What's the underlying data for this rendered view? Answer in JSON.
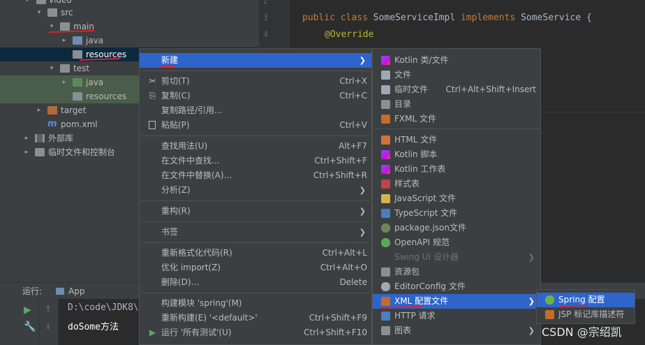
{
  "tree": {
    "items": [
      {
        "label": "video",
        "indent": 1,
        "arrow": "▸",
        "icon": "folder-grey"
      },
      {
        "label": "src",
        "indent": 1,
        "arrow": "▾",
        "icon": "folder-grey"
      },
      {
        "label": "main",
        "indent": 2,
        "arrow": "▾",
        "icon": "folder-grey"
      },
      {
        "label": "java",
        "indent": 3,
        "arrow": "▸",
        "icon": "folder-blue"
      },
      {
        "label": "resources",
        "indent": 3,
        "arrow": "",
        "icon": "folder-res"
      },
      {
        "label": "test",
        "indent": 2,
        "arrow": "▾",
        "icon": "folder-grey"
      },
      {
        "label": "java",
        "indent": 3,
        "arrow": "▸",
        "icon": "folder-blue"
      },
      {
        "label": "resources",
        "indent": 3,
        "arrow": "",
        "icon": "folder-res"
      },
      {
        "label": "target",
        "indent": 1,
        "arrow": "▸",
        "icon": "folder-brown"
      },
      {
        "label": "pom.xml",
        "indent": 1,
        "arrow": "",
        "icon": "maven"
      },
      {
        "label": "外部库",
        "indent": 0,
        "arrow": "▸",
        "icon": "lib"
      },
      {
        "label": "临时文件和控制台",
        "indent": 0,
        "arrow": "▸",
        "icon": "scratch"
      }
    ]
  },
  "editor": {
    "line_numbers": [
      "2",
      "3",
      "4"
    ],
    "code": {
      "l1_kw1": "public class ",
      "l1_name": "SomeServiceImpl ",
      "l1_kw2": "implements ",
      "l1_iface": "SomeService {",
      "l2_ann": "@Override"
    }
  },
  "run": {
    "label": "运行:",
    "tab": "App",
    "output_line1": "D:\\code\\JDK8\\",
    "output_line2": "doSome方法"
  },
  "menu1": {
    "items": [
      {
        "label": "新建",
        "shortcut": "",
        "submenu": true,
        "icon": ""
      },
      {
        "label": "剪切(T)",
        "shortcut": "Ctrl+X",
        "submenu": false,
        "icon": "✂"
      },
      {
        "label": "复制(C)",
        "shortcut": "Ctrl+C",
        "submenu": false,
        "icon": "⎘"
      },
      {
        "label": "复制路径/引用...",
        "shortcut": "",
        "submenu": false,
        "icon": ""
      },
      {
        "label": "粘贴(P)",
        "shortcut": "Ctrl+V",
        "submenu": false,
        "icon": "📋"
      },
      {
        "label": "查找用法(U)",
        "shortcut": "Alt+F7",
        "submenu": false,
        "icon": ""
      },
      {
        "label": "在文件中查找...",
        "shortcut": "Ctrl+Shift+F",
        "submenu": false,
        "icon": ""
      },
      {
        "label": "在文件中替换(A)...",
        "shortcut": "Ctrl+Shift+R",
        "submenu": false,
        "icon": ""
      },
      {
        "label": "分析(Z)",
        "shortcut": "",
        "submenu": true,
        "icon": ""
      },
      {
        "label": "重构(R)",
        "shortcut": "",
        "submenu": true,
        "icon": ""
      },
      {
        "label": "书签",
        "shortcut": "",
        "submenu": true,
        "icon": ""
      },
      {
        "label": "重新格式化代码(R)",
        "shortcut": "Ctrl+Alt+L",
        "submenu": false,
        "icon": ""
      },
      {
        "label": "优化 import(Z)",
        "shortcut": "Ctrl+Alt+O",
        "submenu": false,
        "icon": ""
      },
      {
        "label": "删除(D)...",
        "shortcut": "Delete",
        "submenu": false,
        "icon": ""
      },
      {
        "label": "构建模块 'spring'(M)",
        "shortcut": "",
        "submenu": false,
        "icon": ""
      },
      {
        "label": "重新构建(E) '<default>'",
        "shortcut": "Ctrl+Shift+F9",
        "submenu": false,
        "icon": ""
      },
      {
        "label": "运行 '所有测试'(U)",
        "shortcut": "Ctrl+Shift+F10",
        "submenu": false,
        "icon": "▶"
      }
    ]
  },
  "menu2": {
    "items": [
      {
        "label": "Kotlin 类/文件",
        "shortcut": "",
        "submenu": false,
        "icon": "kotlin"
      },
      {
        "label": "文件",
        "shortcut": "",
        "submenu": false,
        "icon": "file"
      },
      {
        "label": "临时文件",
        "shortcut": "Ctrl+Alt+Shift+Insert",
        "submenu": false,
        "icon": "file"
      },
      {
        "label": "目录",
        "shortcut": "",
        "submenu": false,
        "icon": "dir"
      },
      {
        "label": "FXML 文件",
        "shortcut": "",
        "submenu": false,
        "icon": "fxml"
      },
      {
        "label": "HTML 文件",
        "shortcut": "",
        "submenu": false,
        "icon": "html"
      },
      {
        "label": "Kotlin 脚本",
        "shortcut": "",
        "submenu": false,
        "icon": "kotlin"
      },
      {
        "label": "Kotlin 工作表",
        "shortcut": "",
        "submenu": false,
        "icon": "kotlin"
      },
      {
        "label": "样式表",
        "shortcut": "",
        "submenu": false,
        "icon": "css"
      },
      {
        "label": "JavaScript 文件",
        "shortcut": "",
        "submenu": false,
        "icon": "js"
      },
      {
        "label": "TypeScript 文件",
        "shortcut": "",
        "submenu": false,
        "icon": "ts"
      },
      {
        "label": "package.json文件",
        "shortcut": "",
        "submenu": false,
        "icon": "pkg"
      },
      {
        "label": "OpenAPI 规范",
        "shortcut": "",
        "submenu": false,
        "icon": "openapi"
      },
      {
        "label": "Swing UI 设计器",
        "shortcut": "",
        "submenu": true,
        "icon": ""
      },
      {
        "label": "资源包",
        "shortcut": "",
        "submenu": false,
        "icon": "res"
      },
      {
        "label": "EditorConfig 文件",
        "shortcut": "",
        "submenu": false,
        "icon": "gear"
      },
      {
        "label": "XML 配置文件",
        "shortcut": "",
        "submenu": true,
        "icon": "xml"
      },
      {
        "label": "HTTP 请求",
        "shortcut": "",
        "submenu": false,
        "icon": "api"
      },
      {
        "label": "图表",
        "shortcut": "",
        "submenu": true,
        "icon": "dir"
      }
    ]
  },
  "menu3": {
    "items": [
      {
        "label": "Spring 配置",
        "icon": "spring"
      },
      {
        "label": "JSP 标记库描述符",
        "icon": "jsp"
      }
    ]
  },
  "watermark": "CSDN @宗绍凯",
  "colors": {
    "accent": "#2f65ca",
    "annotation_red": "#e0202a",
    "selection": "#0d293e"
  }
}
